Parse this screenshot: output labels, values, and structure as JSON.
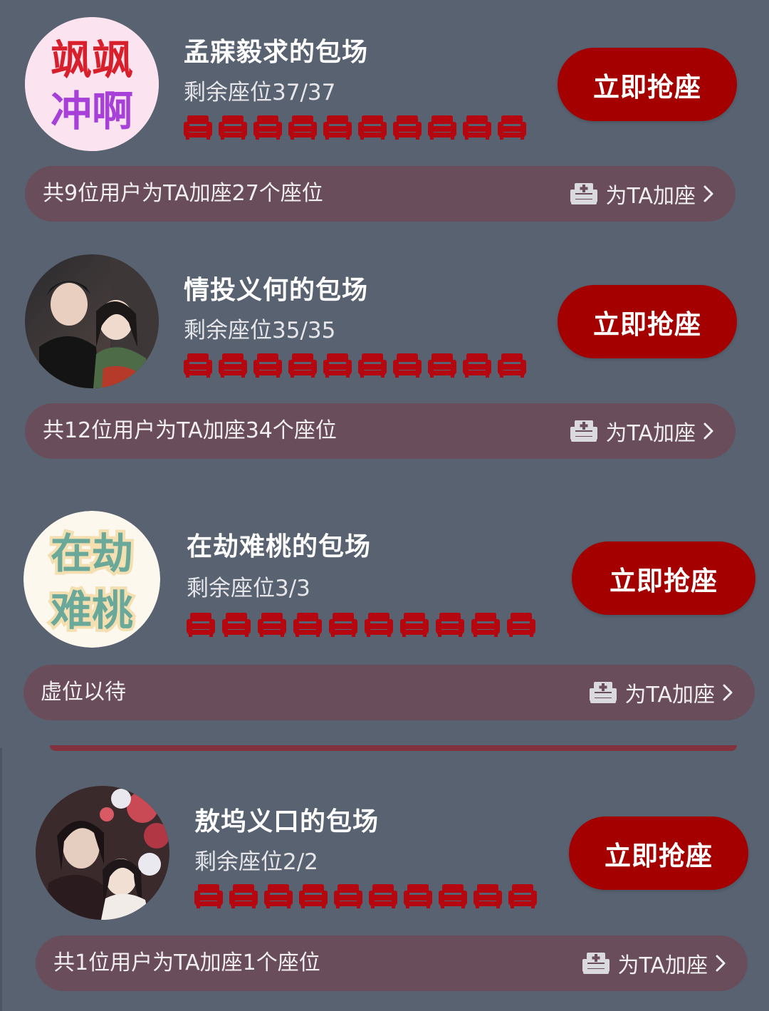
{
  "cards": [
    {
      "title": "孟寐毅求的包场",
      "remaining": "剩余座位37/37",
      "button": "立即抢座",
      "bar_text": "共9位用户为TA加座27个座位",
      "add_label": "为TA加座",
      "avatar": {
        "type": "text",
        "line1": "飒飒",
        "line2": "冲啊",
        "colors": [
          "#d8202c",
          "#a640d8"
        ]
      },
      "seat_count": 10
    },
    {
      "title": "情投义何的包场",
      "remaining": "剩余座位35/35",
      "button": "立即抢座",
      "bar_text": "共12位用户为TA加座34个座位",
      "add_label": "为TA加座",
      "avatar": {
        "type": "photo"
      },
      "seat_count": 10
    },
    {
      "title": "在劫难桃的包场",
      "remaining": "剩余座位3/3",
      "button": "立即抢座",
      "bar_text": "虚位以待",
      "add_label": "为TA加座",
      "avatar": {
        "type": "text",
        "line1": "在劫",
        "line2": "难桃",
        "colors": [
          "#6aa89a",
          "#6aa89a"
        ]
      },
      "seat_count": 10
    },
    {
      "title": "敖坞义口的包场",
      "remaining": "剩余座位2/2",
      "button": "立即抢座",
      "bar_text": "共1位用户为TA加座1个座位",
      "add_label": "为TA加座",
      "avatar": {
        "type": "photo"
      },
      "seat_count": 10
    }
  ],
  "colors": {
    "background": "#586270",
    "button": "#a40000",
    "bar": "#6a4d5b",
    "seat": "#b5070f"
  },
  "icons": [
    "seat-icon",
    "add-seat-icon",
    "chevron-right-icon"
  ]
}
